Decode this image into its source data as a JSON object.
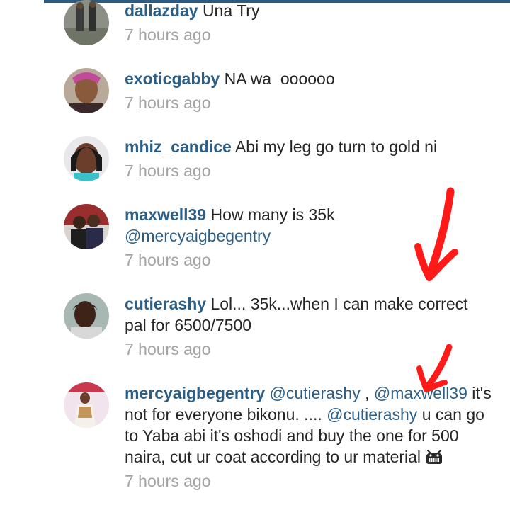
{
  "comments": [
    {
      "user": "dallazday",
      "text": "Una Try",
      "time": "7 hours ago"
    },
    {
      "user": "exoticgabby",
      "text": "NA wa  oooooo",
      "time": "7 hours ago"
    },
    {
      "user": "mhiz_candice",
      "text": "Abi my leg go turn to gold ni",
      "time": "7 hours ago"
    },
    {
      "user": "maxwell39",
      "text": "How many is 35k",
      "mention": "@mercyaigbegentry",
      "time": "7 hours ago"
    },
    {
      "user": "cutierashy",
      "text": "Lol... 35k...when I can make correct pal for 6500/7500",
      "time": "7 hours ago"
    },
    {
      "user": "mercyaigbegentry",
      "mention1": "@cutierashy",
      "sep": ",",
      "mention2": "@maxwell39",
      "text1": "it's not for everyone bikonu. ....",
      "mention3": "@cutierashy",
      "text2": "u can go to Yaba abi it's oshodi and buy the one for 500 naira, cut ur coat according to ur material",
      "time": "7 hours ago"
    }
  ],
  "icons": {
    "emoji": "grinning-alien-emoji",
    "arrow_large": "red-arrow-annotation",
    "arrow_small": "red-arrow-annotation"
  },
  "colors": {
    "username": "#2d5f86",
    "timestamp": "#a3a3a3",
    "text": "#262626",
    "annotation": "#ff1a1a"
  }
}
